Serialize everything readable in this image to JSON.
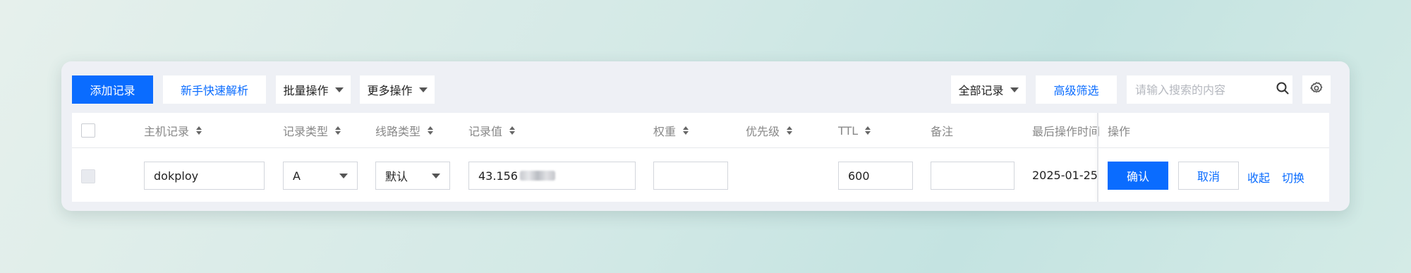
{
  "toolbar": {
    "add_record": "添加记录",
    "quick_resolve": "新手快速解析",
    "batch_ops": "批量操作",
    "more_ops": "更多操作",
    "all_records": "全部记录",
    "advanced_filter": "高级筛选",
    "search_placeholder": "请输入搜索的内容"
  },
  "table": {
    "columns": {
      "host": "主机记录",
      "type": "记录类型",
      "line": "线路类型",
      "value": "记录值",
      "weight": "权重",
      "priority": "优先级",
      "ttl": "TTL",
      "remark": "备注",
      "last_op_time": "最后操作时间",
      "actions": "操作"
    },
    "edit_row": {
      "host": "dokploy",
      "type": "A",
      "line": "默认",
      "value": "43.156",
      "weight": "",
      "ttl": "600",
      "remark": "",
      "last_op_time": "2025-01-25",
      "confirm": "确认",
      "cancel": "取消",
      "collapse": "收起",
      "switch": "切换"
    }
  },
  "colors": {
    "primary": "#0a6cff",
    "panel_bg": "#eef0f5"
  },
  "icons": [
    "search-icon",
    "gear-icon",
    "caret-down-icon",
    "sort-icon"
  ]
}
